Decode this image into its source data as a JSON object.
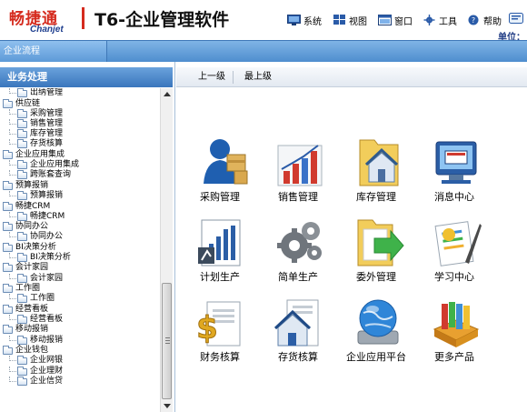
{
  "header": {
    "logo_cn": "畅捷通",
    "logo_en": "Chanjet",
    "product": "T6-企业管理软件",
    "menu": [
      {
        "label": "系统",
        "icon": "system-icon"
      },
      {
        "label": "视图",
        "icon": "view-icon"
      },
      {
        "label": "窗口",
        "icon": "window-icon"
      },
      {
        "label": "工具",
        "icon": "tools-icon"
      },
      {
        "label": "帮助",
        "icon": "help-icon"
      }
    ],
    "unit_label": "单位："
  },
  "tabbar": {
    "current_tab": "企业流程"
  },
  "sidebar": {
    "title": "业务处理",
    "items": [
      {
        "label": "出纳管理",
        "level": 1
      },
      {
        "label": "供应链",
        "level": 0
      },
      {
        "label": "采购管理",
        "level": 1
      },
      {
        "label": "销售管理",
        "level": 1
      },
      {
        "label": "库存管理",
        "level": 1
      },
      {
        "label": "存货核算",
        "level": 1
      },
      {
        "label": "企业应用集成",
        "level": 0
      },
      {
        "label": "企业应用集成",
        "level": 1
      },
      {
        "label": "跨账套查询",
        "level": 1
      },
      {
        "label": "预算报销",
        "level": 0
      },
      {
        "label": "预算报销",
        "level": 1
      },
      {
        "label": "畅捷CRM",
        "level": 0
      },
      {
        "label": "畅捷CRM",
        "level": 1
      },
      {
        "label": "协同办公",
        "level": 0
      },
      {
        "label": "协同办公",
        "level": 1
      },
      {
        "label": "BI决策分析",
        "level": 0
      },
      {
        "label": "BI决策分析",
        "level": 1
      },
      {
        "label": "会计家园",
        "level": 0
      },
      {
        "label": "会计家园",
        "level": 1
      },
      {
        "label": "工作圈",
        "level": 0
      },
      {
        "label": "工作圈",
        "level": 1
      },
      {
        "label": "经营看板",
        "level": 0
      },
      {
        "label": "经营看板",
        "level": 1
      },
      {
        "label": "移动报销",
        "level": 0
      },
      {
        "label": "移动报销",
        "level": 1
      },
      {
        "label": "企业钱包",
        "level": 0
      },
      {
        "label": "企业网银",
        "level": 1
      },
      {
        "label": "企业理财",
        "level": 1
      },
      {
        "label": "企业信贷",
        "level": 1
      }
    ]
  },
  "toolbar": {
    "up_label": "上一级",
    "top_label": "最上级"
  },
  "apps": [
    {
      "label": "采购管理",
      "icon": "purchase-icon"
    },
    {
      "label": "销售管理",
      "icon": "sales-chart-icon"
    },
    {
      "label": "库存管理",
      "icon": "inventory-icon"
    },
    {
      "label": "消息中心",
      "icon": "message-center-icon"
    },
    {
      "label": "计划生产",
      "icon": "plan-production-icon"
    },
    {
      "label": "简单生产",
      "icon": "gears-icon"
    },
    {
      "label": "委外管理",
      "icon": "outsourcing-icon"
    },
    {
      "label": "学习中心",
      "icon": "learning-center-icon"
    },
    {
      "label": "财务核算",
      "icon": "finance-icon"
    },
    {
      "label": "存货核算",
      "icon": "stock-accounting-icon"
    },
    {
      "label": "企业应用平台",
      "icon": "platform-globe-icon"
    },
    {
      "label": "更多产品",
      "icon": "more-products-icon"
    }
  ]
}
